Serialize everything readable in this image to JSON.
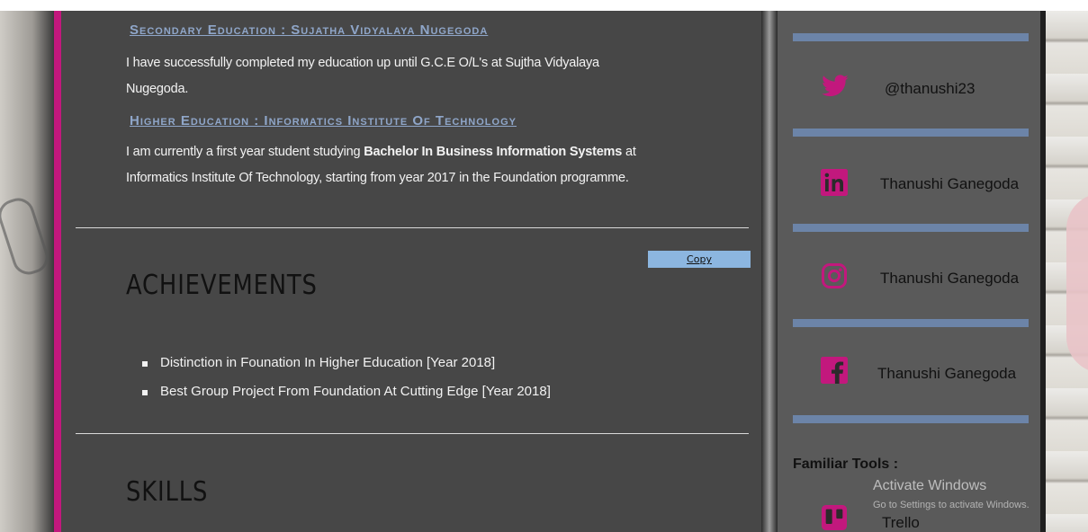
{
  "education": {
    "secondary_heading": "Secondary Education : Sujatha Vidyalaya Nugegoda",
    "secondary_text_1": "I have successfully completed my education up until G.C.E O/L's at Sujtha Vidyalaya",
    "secondary_text_2": "Nugegoda.",
    "higher_heading": "Higher Education : Informatics Institute Of Technology",
    "higher_text_a": "I am currently a first year student studying ",
    "higher_text_bold": "Bachelor In Business Information Systems",
    "higher_text_b": " at",
    "higher_text_2": "Informatics Institute Of Technology, starting from year 2017 in the Foundation programme."
  },
  "copy_button": {
    "label": "Copy"
  },
  "achievements": {
    "title": "ACHIEVEMENTS",
    "items": [
      "Distinction in Founation In Higher Education [Year 2018]",
      "Best Group Project From Foundation At Cutting Edge [Year 2018]"
    ]
  },
  "skills": {
    "title": "SKILLS"
  },
  "sidebar": {
    "twitter": {
      "label": "@thanushi23",
      "icon": "twitter-icon"
    },
    "linkedin": {
      "label": "Thanushi Ganegoda",
      "icon": "linkedin-icon"
    },
    "instagram": {
      "label": "Thanushi Ganegoda",
      "icon": "instagram-icon"
    },
    "facebook": {
      "label": "Thanushi Ganegoda",
      "icon": "facebook-icon"
    },
    "tools_title": "Familiar Tools :",
    "trello": {
      "label": "Trello",
      "icon": "trello-icon"
    }
  },
  "watermark": {
    "title": "Activate Windows",
    "subtitle": "Go to Settings to activate Windows."
  },
  "colors": {
    "accent": "#c2187d",
    "heading_link": "#8fa6c9",
    "sidebar_bar": "#6c84a8",
    "icon_pink": "#c2187d"
  }
}
